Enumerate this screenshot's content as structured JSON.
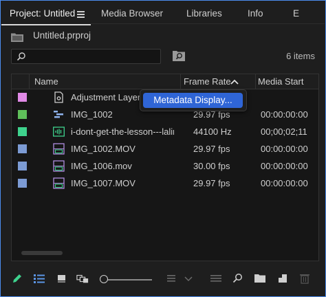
{
  "tabs": [
    {
      "label": "Project: Untitled"
    },
    {
      "label": "Media Browser"
    },
    {
      "label": "Libraries"
    },
    {
      "label": "Info"
    },
    {
      "label": "E"
    }
  ],
  "project": {
    "file_name": "Untitled.prproj"
  },
  "search": {
    "value": "",
    "placeholder": ""
  },
  "items_count": "6 items",
  "table": {
    "columns": {
      "name": "Name",
      "frame_rate": "Frame Rate",
      "media_start": "Media Start"
    },
    "sort": {
      "column": "Frame Rate",
      "direction": "ascending"
    },
    "rows": [
      {
        "color": "#e08ae6",
        "icon": "adjustment-layer-icon",
        "name": "Adjustment Layer",
        "frame_rate": "",
        "media_start": ""
      },
      {
        "color": "#5fbf5a",
        "icon": "sequence-icon",
        "name": "IMG_1002",
        "frame_rate": "29.97 fps",
        "media_start": "00:00:00:00"
      },
      {
        "color": "#3ed28d",
        "icon": "audio-clip-icon",
        "name": "i-dont-get-the-lesson---lalin",
        "frame_rate": "44100 Hz",
        "media_start": "00;00;02;11"
      },
      {
        "color": "#7c9bd4",
        "icon": "video-clip-icon",
        "name": "IMG_1002.MOV",
        "frame_rate": "29.97 fps",
        "media_start": "00:00:00:00"
      },
      {
        "color": "#7c9bd4",
        "icon": "video-clip-icon",
        "name": "IMG_1006.mov",
        "frame_rate": "30.00 fps",
        "media_start": "00:00:00:00"
      },
      {
        "color": "#7c9bd4",
        "icon": "video-clip-icon",
        "name": "IMG_1007.MOV",
        "frame_rate": "29.97 fps",
        "media_start": "00:00:00:00"
      }
    ]
  },
  "context_menu": {
    "item": "Metadata Display..."
  },
  "toolbar": {
    "icons": [
      "pencil-icon",
      "list-view-icon",
      "icon-view-icon",
      "freeform-view-icon",
      "zoom-slider",
      "sort-icons-icon",
      "automate-to-sequence-icon",
      "find-icon",
      "new-bin-icon",
      "new-item-icon",
      "clear-icon"
    ]
  },
  "colors": {
    "accent": "#2f65d6",
    "panel_border": "#4c8cf0"
  }
}
